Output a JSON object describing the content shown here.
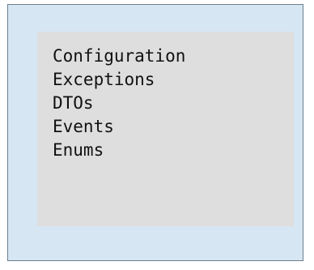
{
  "package": {
    "items": [
      {
        "label": "Configuration"
      },
      {
        "label": "Exceptions"
      },
      {
        "label": "DTOs"
      },
      {
        "label": "Events"
      },
      {
        "label": "Enums"
      }
    ]
  },
  "colors": {
    "outer_fill": "#d6e6f3",
    "outer_border": "#6d7f8e",
    "inner_fill": "#dedede",
    "text": "#111111"
  }
}
